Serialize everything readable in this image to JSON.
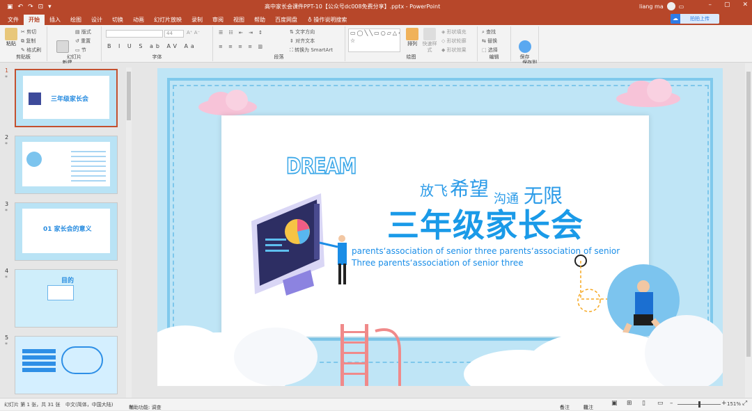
{
  "window": {
    "title": "高中家长会课件PPT-10【公众号dc008免费分享】.pptx  -  PowerPoint",
    "user": "liang ma",
    "share_label": "拍拍上传"
  },
  "quick_access": [
    "save-icon",
    "undo-icon",
    "redo-icon",
    "start-from-beginning-icon",
    "customize-icon"
  ],
  "tabs": [
    "文件",
    "开始",
    "插入",
    "绘图",
    "设计",
    "切换",
    "动画",
    "幻灯片放映",
    "录制",
    "审阅",
    "视图",
    "帮助",
    "百度网盘"
  ],
  "active_tab": "开始",
  "tell_me": "操作说明搜索",
  "ribbon": {
    "clipboard": {
      "paste": "粘贴",
      "cut": "剪切",
      "copy": "复制",
      "format_painter": "格式刷",
      "label": "剪贴板"
    },
    "slides": {
      "new_slide": "新建\n幻灯片",
      "layout": "版式",
      "reset": "重置",
      "section": "节",
      "label": "幻灯片"
    },
    "font": {
      "font_name": "",
      "font_size": "44",
      "format_row": "B I U S ab AV Aa",
      "label": "字体"
    },
    "paragraph": {
      "text_direction": "文字方向",
      "align_text": "对齐文本",
      "smartart": "转换为 SmartArt",
      "label": "段落"
    },
    "drawing": {
      "arrange": "排列",
      "quick_styles": "快速样式",
      "shape_fill": "形状填充",
      "shape_outline": "形状轮廓",
      "shape_effects": "形状效果",
      "label": "绘图"
    },
    "editing": {
      "find": "查找",
      "replace": "替换",
      "select": "选择",
      "label": "编辑"
    },
    "save": {
      "save_to": "保存到\n百度网盘",
      "label": "保存"
    }
  },
  "thumbnails": [
    {
      "num": "1",
      "title": "三年级家长会"
    },
    {
      "num": "2",
      "title": ""
    },
    {
      "num": "3",
      "title": "01 家长会的意义"
    },
    {
      "num": "4",
      "title": "目的"
    },
    {
      "num": "5",
      "title": ""
    }
  ],
  "slide": {
    "dream": "DREAM",
    "sub_a": "放飞",
    "sub_b": "希望",
    "sub_c": "沟通",
    "sub_d": "无限",
    "title": "三年级家长会",
    "en_line1": "parents‘association of senior three parents‘association of senior",
    "en_line2": "Three parents‘association of senior three"
  },
  "status": {
    "slide_info": "幻灯片 第 1 张，共 31 张",
    "language": "中文(简体，中国大陆)",
    "accessibility": "辅助功能: 调查",
    "notes": "备注",
    "comments": "批注",
    "zoom": "151%"
  },
  "colors": {
    "brand": "#b7472a",
    "accent": "#2b9be8",
    "slide_bg": "#bfe5f6"
  }
}
